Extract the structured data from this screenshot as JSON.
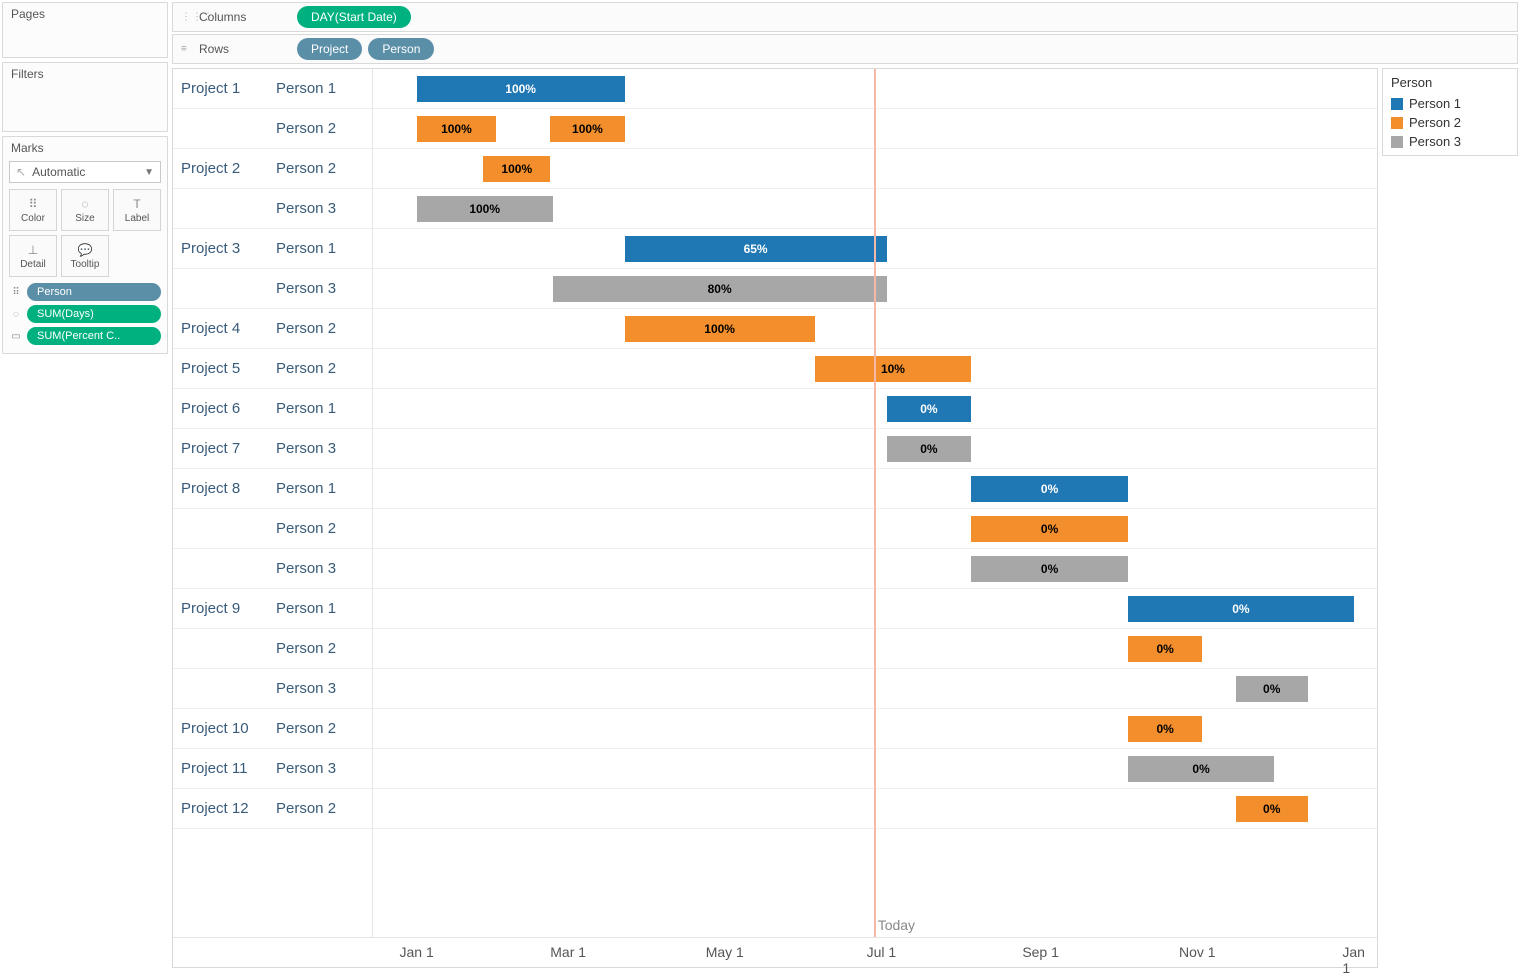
{
  "panels": {
    "pages": "Pages",
    "filters": "Filters",
    "marks": "Marks",
    "marks_type": "Automatic",
    "mark_buttons": [
      "Color",
      "Size",
      "Label",
      "Detail",
      "Tooltip"
    ],
    "mark_shelf": [
      {
        "icon": "⠿",
        "label": "Person",
        "color": "blue"
      },
      {
        "icon": "◌",
        "label": "SUM(Days)",
        "color": "green"
      },
      {
        "icon": "▭",
        "label": "SUM(Percent C..",
        "color": "green"
      }
    ]
  },
  "shelves": {
    "columns_label": "Columns",
    "rows_label": "Rows",
    "columns": [
      {
        "text": "DAY(Start Date)",
        "color": "green"
      }
    ],
    "rows": [
      {
        "text": "Project",
        "color": "blue"
      },
      {
        "text": "Person",
        "color": "blue"
      }
    ]
  },
  "legend": {
    "title": "Person",
    "items": [
      {
        "label": "Person 1",
        "cls": "blue"
      },
      {
        "label": "Person 2",
        "cls": "orange"
      },
      {
        "label": "Person 3",
        "cls": "gray"
      }
    ]
  },
  "axis": {
    "start": "2014-12-15",
    "end": "2016-01-10",
    "ticks": [
      {
        "label": "Jan 1",
        "date": "2015-01-01"
      },
      {
        "label": "Mar 1",
        "date": "2015-03-01"
      },
      {
        "label": "May 1",
        "date": "2015-05-01"
      },
      {
        "label": "Jul 1",
        "date": "2015-07-01"
      },
      {
        "label": "Sep 1",
        "date": "2015-09-01"
      },
      {
        "label": "Nov 1",
        "date": "2015-11-01"
      },
      {
        "label": "Jan 1",
        "date": "2016-01-01"
      }
    ],
    "today": {
      "date": "2015-06-28",
      "label": "Today"
    }
  },
  "chart_data": {
    "type": "bar",
    "orientation": "gantt",
    "xlabel": "",
    "ylabel": "",
    "x_domain": [
      "2014-12-15",
      "2016-01-10"
    ],
    "color_field": "person",
    "color_map": {
      "Person 1": "#1f77b4",
      "Person 2": "#f28e2b",
      "Person 3": "#a7a7a7"
    },
    "label_field": "percent_complete",
    "rows": [
      {
        "project": "Project 1",
        "person": "Person 1",
        "bars": [
          {
            "start": "2015-01-01",
            "end": "2015-03-23",
            "pct": "100%"
          }
        ]
      },
      {
        "project": "Project 1",
        "person": "Person 2",
        "bars": [
          {
            "start": "2015-01-01",
            "end": "2015-02-01",
            "pct": "100%"
          },
          {
            "start": "2015-02-22",
            "end": "2015-03-23",
            "pct": "100%"
          }
        ]
      },
      {
        "project": "Project 2",
        "person": "Person 2",
        "bars": [
          {
            "start": "2015-01-27",
            "end": "2015-02-22",
            "pct": "100%"
          }
        ]
      },
      {
        "project": "Project 2",
        "person": "Person 3",
        "bars": [
          {
            "start": "2015-01-01",
            "end": "2015-02-23",
            "pct": "100%"
          }
        ]
      },
      {
        "project": "Project 3",
        "person": "Person 1",
        "bars": [
          {
            "start": "2015-03-23",
            "end": "2015-07-03",
            "pct": "65%"
          }
        ]
      },
      {
        "project": "Project 3",
        "person": "Person 3",
        "bars": [
          {
            "start": "2015-02-23",
            "end": "2015-07-03",
            "pct": "80%"
          }
        ]
      },
      {
        "project": "Project 4",
        "person": "Person 2",
        "bars": [
          {
            "start": "2015-03-23",
            "end": "2015-06-05",
            "pct": "100%"
          }
        ]
      },
      {
        "project": "Project 5",
        "person": "Person 2",
        "bars": [
          {
            "start": "2015-06-05",
            "end": "2015-08-05",
            "pct": "10%"
          }
        ]
      },
      {
        "project": "Project 6",
        "person": "Person 1",
        "bars": [
          {
            "start": "2015-07-03",
            "end": "2015-08-05",
            "pct": "0%"
          }
        ]
      },
      {
        "project": "Project 7",
        "person": "Person 3",
        "bars": [
          {
            "start": "2015-07-03",
            "end": "2015-08-05",
            "pct": "0%"
          }
        ]
      },
      {
        "project": "Project 8",
        "person": "Person 1",
        "bars": [
          {
            "start": "2015-08-05",
            "end": "2015-10-05",
            "pct": "0%"
          }
        ]
      },
      {
        "project": "Project 8",
        "person": "Person 2",
        "bars": [
          {
            "start": "2015-08-05",
            "end": "2015-10-05",
            "pct": "0%"
          }
        ]
      },
      {
        "project": "Project 8",
        "person": "Person 3",
        "bars": [
          {
            "start": "2015-08-05",
            "end": "2015-10-05",
            "pct": "0%"
          }
        ]
      },
      {
        "project": "Project 9",
        "person": "Person 1",
        "bars": [
          {
            "start": "2015-10-05",
            "end": "2016-01-01",
            "pct": "0%"
          }
        ]
      },
      {
        "project": "Project 9",
        "person": "Person 2",
        "bars": [
          {
            "start": "2015-10-05",
            "end": "2015-11-03",
            "pct": "0%"
          }
        ]
      },
      {
        "project": "Project 9",
        "person": "Person 3",
        "bars": [
          {
            "start": "2015-11-16",
            "end": "2015-12-14",
            "pct": "0%"
          }
        ]
      },
      {
        "project": "Project 10",
        "person": "Person 2",
        "bars": [
          {
            "start": "2015-10-05",
            "end": "2015-11-03",
            "pct": "0%"
          }
        ]
      },
      {
        "project": "Project 11",
        "person": "Person 3",
        "bars": [
          {
            "start": "2015-10-05",
            "end": "2015-12-01",
            "pct": "0%"
          }
        ]
      },
      {
        "project": "Project 12",
        "person": "Person 2",
        "bars": [
          {
            "start": "2015-11-16",
            "end": "2015-12-14",
            "pct": "0%"
          }
        ]
      }
    ]
  }
}
